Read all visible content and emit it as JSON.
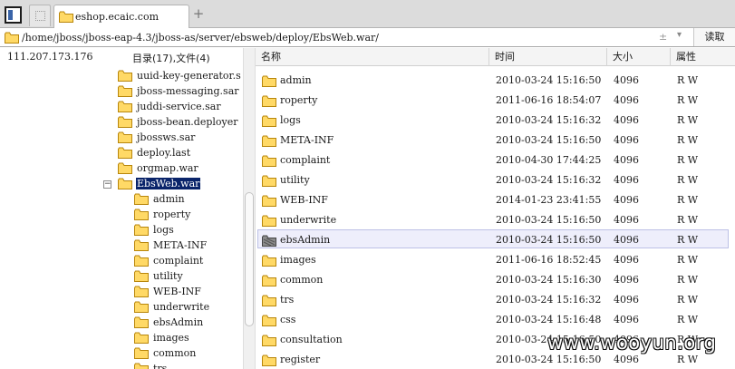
{
  "tabbar": {
    "tab_title": "eshop.ecaic.com",
    "new_tab": "+"
  },
  "addressbar": {
    "path": "/home/jboss/jboss-eap-4.3/jboss-as/server/ebsweb/deploy/EbsWeb.war/",
    "plusminus": "±",
    "dropdown": "▾",
    "read_button": "读取"
  },
  "left": {
    "ip": "111.207.173.176",
    "dir_count": "目录(17),文件(4)",
    "collapse_symbol": "−",
    "tree": [
      {
        "label": "uuid-key-generator.s",
        "level": 0
      },
      {
        "label": "jboss-messaging.sar",
        "level": 0
      },
      {
        "label": "juddi-service.sar",
        "level": 0
      },
      {
        "label": "jboss-bean.deployer",
        "level": 0
      },
      {
        "label": "jbossws.sar",
        "level": 0
      },
      {
        "label": "deploy.last",
        "level": 0
      },
      {
        "label": "orgmap.war",
        "level": 0
      },
      {
        "label": "EbsWeb.war",
        "level": 0,
        "selected": true,
        "open": true
      },
      {
        "label": "admin",
        "level": 1
      },
      {
        "label": "roperty",
        "level": 1
      },
      {
        "label": "logs",
        "level": 1
      },
      {
        "label": "META-INF",
        "level": 1
      },
      {
        "label": "complaint",
        "level": 1
      },
      {
        "label": "utility",
        "level": 1
      },
      {
        "label": "WEB-INF",
        "level": 1
      },
      {
        "label": "underwrite",
        "level": 1
      },
      {
        "label": "ebsAdmin",
        "level": 1
      },
      {
        "label": "images",
        "level": 1
      },
      {
        "label": "common",
        "level": 1
      },
      {
        "label": "trs",
        "level": 1
      }
    ]
  },
  "filelist": {
    "columns": [
      "名称",
      "时间",
      "大小",
      "属性"
    ],
    "rows": [
      {
        "name": "admin",
        "time": "2010-03-24 15:16:50",
        "size": "4096",
        "attr": "R W"
      },
      {
        "name": "roperty",
        "time": "2011-06-16 18:54:07",
        "size": "4096",
        "attr": "R W"
      },
      {
        "name": "logs",
        "time": "2010-03-24 15:16:32",
        "size": "4096",
        "attr": "R W"
      },
      {
        "name": "META-INF",
        "time": "2010-03-24 15:16:50",
        "size": "4096",
        "attr": "R W"
      },
      {
        "name": "complaint",
        "time": "2010-04-30 17:44:25",
        "size": "4096",
        "attr": "R W"
      },
      {
        "name": "utility",
        "time": "2010-03-24 15:16:32",
        "size": "4096",
        "attr": "R W"
      },
      {
        "name": "WEB-INF",
        "time": "2014-01-23 23:41:55",
        "size": "4096",
        "attr": "R W"
      },
      {
        "name": "underwrite",
        "time": "2010-03-24 15:16:50",
        "size": "4096",
        "attr": "R W"
      },
      {
        "name": "ebsAdmin",
        "time": "2010-03-24 15:16:50",
        "size": "4096",
        "attr": "R W",
        "selected": true
      },
      {
        "name": "images",
        "time": "2011-06-16 18:52:45",
        "size": "4096",
        "attr": "R W"
      },
      {
        "name": "common",
        "time": "2010-03-24 15:16:30",
        "size": "4096",
        "attr": "R W"
      },
      {
        "name": "trs",
        "time": "2010-03-24 15:16:32",
        "size": "4096",
        "attr": "R W"
      },
      {
        "name": "css",
        "time": "2010-03-24 15:16:48",
        "size": "4096",
        "attr": "R W"
      },
      {
        "name": "consultation",
        "time": "2010-03-24 15:16:50",
        "size": "4096",
        "attr": "R W"
      },
      {
        "name": "register",
        "time": "2010-03-24 15:16:50",
        "size": "4096",
        "attr": "R W"
      }
    ]
  },
  "watermark": "www.wooyun.org",
  "colors": {
    "folder_fill": "#ffd966",
    "folder_stroke": "#b8860b",
    "selection": "#0a246a",
    "row_highlight": "#eeeefb"
  },
  "icons": {
    "folder": "folder-icon",
    "selected_folder": "folder-selected-icon",
    "window": "window-icon"
  }
}
